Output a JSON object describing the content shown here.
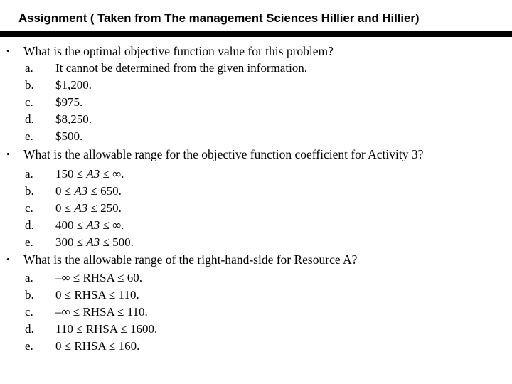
{
  "slide": {
    "title": "Assignment ( Taken from The management Sciences Hillier and Hillier)",
    "bullet_glyph": "•",
    "divider_color": "#000000",
    "background_color": "#ffffff",
    "text_color": "#000000"
  },
  "questions": [
    {
      "prompt": "What is the optimal objective function value for this problem?",
      "options": [
        {
          "letter": "a.",
          "text": "It cannot be determined from the given information."
        },
        {
          "letter": "b.",
          "text": "$1,200."
        },
        {
          "letter": "c.",
          "text": "$975."
        },
        {
          "letter": "d.",
          "text": "$8,250."
        },
        {
          "letter": "e.",
          "text": "$500."
        }
      ]
    },
    {
      "prompt": "What is the allowable range for the objective function coefficient for Activity 3?",
      "options": [
        {
          "letter": "a.",
          "pre": "150 ≤ ",
          "var": "A3",
          "post": " ≤ ∞."
        },
        {
          "letter": "b.",
          "pre": "0 ≤ ",
          "var": "A3",
          "post": " ≤ 650."
        },
        {
          "letter": "c.",
          "pre": "0 ≤ ",
          "var": "A3",
          "post": " ≤ 250."
        },
        {
          "letter": "d.",
          "pre": "400 ≤ ",
          "var": "A3",
          "post": " ≤ ∞."
        },
        {
          "letter": "e.",
          "pre": "300 ≤ ",
          "var": "A3",
          "post": " ≤ 500."
        }
      ]
    },
    {
      "prompt": "What is the allowable range of the right-hand-side for Resource A?",
      "options": [
        {
          "letter": "a.",
          "text": "–∞ ≤ RHSA ≤ 60."
        },
        {
          "letter": "b.",
          "text": "0 ≤ RHSA ≤ 110."
        },
        {
          "letter": "c.",
          "text": "–∞ ≤ RHSA ≤ 110."
        },
        {
          "letter": "d.",
          "text": "110 ≤ RHSA ≤ 1600."
        },
        {
          "letter": "e.",
          "text": "0 ≤ RHSA ≤ 160."
        }
      ]
    }
  ]
}
